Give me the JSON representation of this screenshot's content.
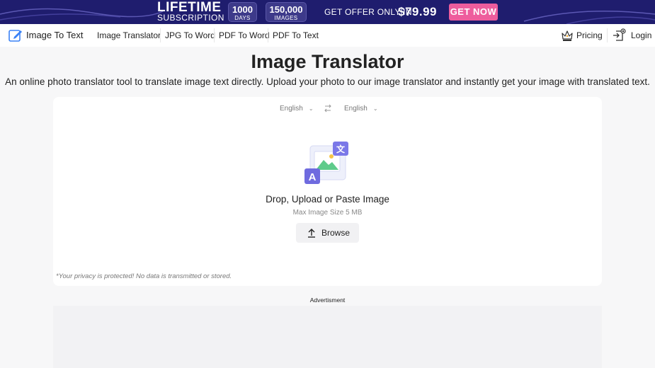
{
  "promo": {
    "headline": "LIFETIME",
    "subheadline": "SUBSCRIPTION",
    "days_value": "1000",
    "days_label": "DAYS",
    "images_value": "150,000",
    "images_label": "IMAGES",
    "offer_text": "GET OFFER ONLY IN",
    "price": "$79.99",
    "cta_label": "GET NOW",
    "colors": {
      "banner": "#1f1d6e",
      "cta": "#ee5d9d"
    }
  },
  "nav": {
    "logo_icon": "edit-note-icon",
    "logo_text": "Image To Text",
    "links": [
      "Image Translator",
      "JPG To Word",
      "PDF To Word",
      "PDF To Text"
    ],
    "pricing_icon": "crown-icon",
    "pricing_label": "Pricing",
    "login_icon": "user-login-icon",
    "login_label": "Login"
  },
  "hero": {
    "title": "Image Translator",
    "subtitle": "An online photo translator tool to translate image text directly. Upload your photo to our image translator and instantly get your image with translated text."
  },
  "translator": {
    "source_language": "English",
    "target_language": "English",
    "swap_icon": "swap-arrows-icon",
    "upload_icon": "image-translate-icon",
    "drop_text": "Drop, Upload or Paste Image",
    "max_size_text": "Max Image Size 5 MB",
    "browse_label": "Browse",
    "browse_icon": "upload-arrow-icon",
    "privacy_text": "*Your privacy is protected! No data is transmitted or stored."
  },
  "ad": {
    "label": "Advertisment"
  }
}
